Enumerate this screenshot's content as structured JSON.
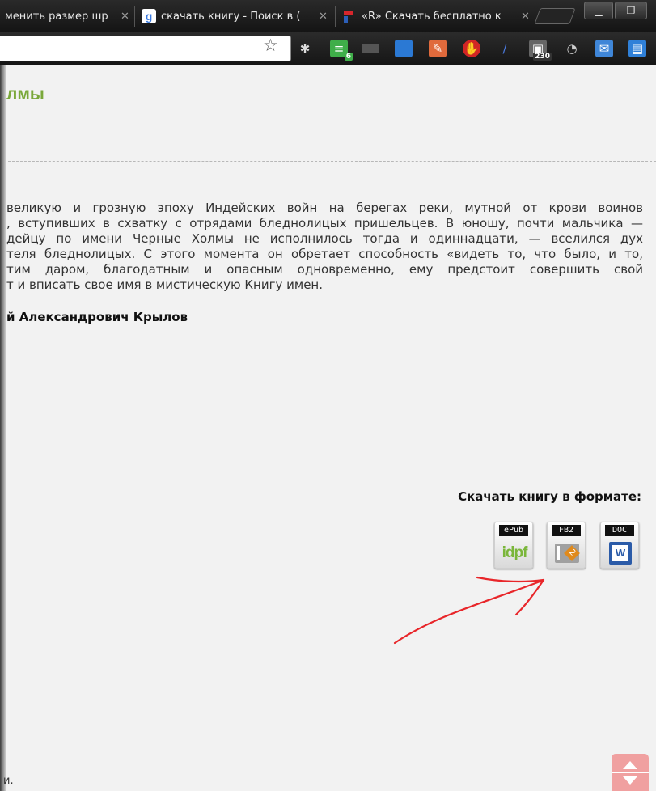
{
  "browser": {
    "tabs": [
      {
        "title": "менить размер шр",
        "active": false
      },
      {
        "title": "скачать книгу - Поиск в (",
        "active": false
      },
      {
        "title": "«R» Скачать бесплатно к",
        "active": true
      }
    ],
    "extensions": [
      {
        "icon": "star-icon"
      },
      {
        "icon": "puzzle-icon"
      },
      {
        "icon": "feeds-icon",
        "badge": "6",
        "color": "#3fae49"
      },
      {
        "icon": "ruler-icon",
        "color": "#555555"
      },
      {
        "icon": "notebook-icon",
        "color": "#2b79d4"
      },
      {
        "icon": "clean-brush-icon",
        "color": "#e06a3c"
      },
      {
        "icon": "adblock-icon",
        "color": "#d22525"
      },
      {
        "icon": "pen-icon",
        "color": "#4a7ae0"
      },
      {
        "icon": "counter-icon",
        "badge": "230",
        "color": "#666666"
      },
      {
        "icon": "clock-icon",
        "color": "#cccccc"
      },
      {
        "icon": "mail-icon",
        "color": "#3f86d8"
      },
      {
        "icon": "window-icon",
        "color": "#2f80d8"
      }
    ]
  },
  "page": {
    "book_title_fragment": "лмы",
    "description_lines": [
      "великую и грозную эпоху Индейских войн на берегах реки, мутной от крови воинов",
      ", вступивших в схватку с отрядами бледнолицых пришельцев. В юношу, почти мальчика —",
      "дейцу по имени Черные Холмы не исполнилось тогда и одиннадцати, — вселился дух",
      "теля бледнолицых. С этого момента он обретает способность «видеть то, что было, и то,",
      "тим даром, благодатным и опасным одновременно, ему предстоит совершить свой",
      "т и вписать свое имя в мистическую Книгу имен."
    ],
    "author_fragment": "й Александрович Крылов",
    "download_label": "Скачать книгу в формате:",
    "formats": [
      {
        "label": "ePub",
        "logo_text": "idpf"
      },
      {
        "label": "FB2"
      },
      {
        "label": "DOC"
      }
    ],
    "footer_fragment": "и.",
    "accent_color": "#7aa83a",
    "annotation_color": "#e8262a"
  }
}
